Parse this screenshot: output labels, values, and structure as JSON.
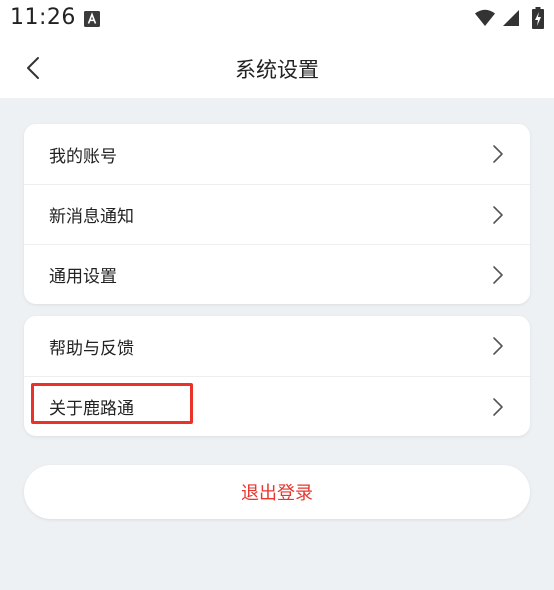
{
  "status_bar": {
    "time": "11:26",
    "notification_icon": "a-letter-badge-icon",
    "wifi_icon": "wifi-icon",
    "signal_icon": "cellular-signal-icon",
    "battery_icon": "battery-charging-icon"
  },
  "header": {
    "back_icon": "chevron-left-icon",
    "title": "系统设置"
  },
  "settings_groups": [
    {
      "items": [
        {
          "label": "我的账号"
        },
        {
          "label": "新消息通知"
        },
        {
          "label": "通用设置"
        }
      ]
    },
    {
      "items": [
        {
          "label": "帮助与反馈"
        },
        {
          "label": "关于鹿路通"
        }
      ]
    }
  ],
  "highlighted_item": "关于鹿路通",
  "logout": {
    "label": "退出登录"
  },
  "colors": {
    "background": "#edf1f4",
    "card": "#ffffff",
    "logout_text": "#e8352e",
    "highlight_border": "#e8322a"
  }
}
